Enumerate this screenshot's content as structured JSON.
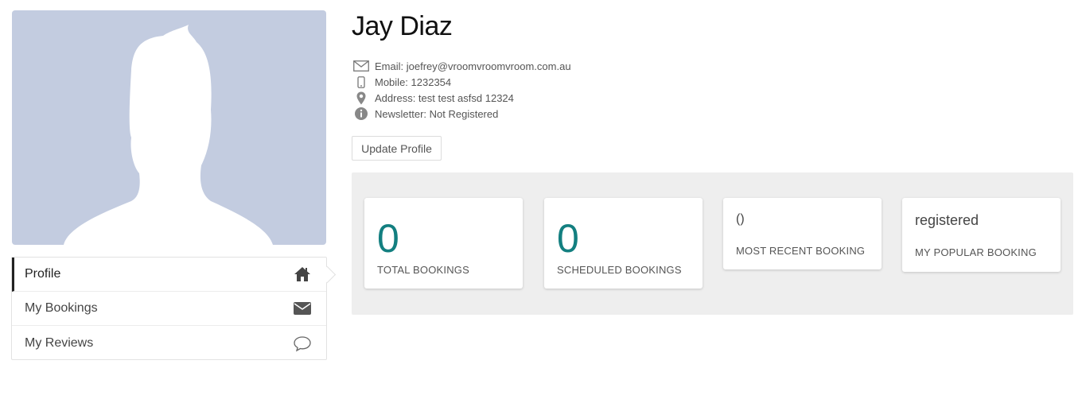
{
  "user": {
    "name": "Jay Diaz"
  },
  "info": [
    {
      "icon": "envelope-icon",
      "text": "Email: joefrey@vroomvroomvroom.com.au"
    },
    {
      "icon": "mobile-phone-icon",
      "text": "Mobile: 1232354"
    },
    {
      "icon": "map-pin-icon",
      "text": "Address: test test asfsd 12324"
    },
    {
      "icon": "info-circle-icon",
      "text": "Newsletter: Not Registered"
    }
  ],
  "actions": {
    "update_profile": "Update Profile"
  },
  "menu": [
    {
      "label": "Profile",
      "icon": "home-icon",
      "active": true
    },
    {
      "label": "My Bookings",
      "icon": "envelope-icon",
      "active": false
    },
    {
      "label": "My Reviews",
      "icon": "speech-bubble-icon",
      "active": false
    }
  ],
  "stats": [
    {
      "value": "0",
      "label": "TOTAL BOOKINGS"
    },
    {
      "value": "0",
      "label": "SCHEDULED BOOKINGS"
    },
    {
      "value": "()",
      "label": "MOST RECENT BOOKING"
    },
    {
      "value": "registered",
      "label": "MY POPULAR BOOKING"
    }
  ],
  "colors": {
    "accent": "#137f80",
    "avatar_bg": "#c3cce0",
    "panel_bg": "#eeeeee"
  }
}
